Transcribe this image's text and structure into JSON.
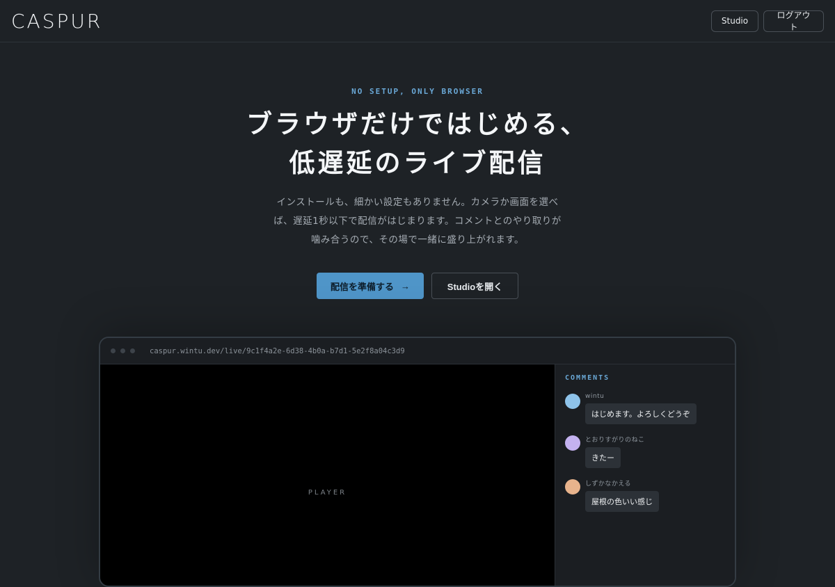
{
  "header": {
    "logo": "CASPUR",
    "studio_label": "Studio",
    "logout_label": "ログアウト"
  },
  "hero": {
    "eyebrow": "NO SETUP, ONLY BROWSER",
    "title_lines": [
      "ブラウザだけではじめる、",
      "低遅延のライブ配信"
    ],
    "lead_lines": [
      "インストールも、細かい設定もありません。カメラか画面を選べ",
      "ば、遅延1秒以下で配信がはじまります。コメントとのやり取りが",
      "噛み合うので、その場で一緒に盛り上がれます。"
    ],
    "primary_cta": "配信を準備する",
    "primary_cta_arrow": "→",
    "secondary_cta": "Studioを開く"
  },
  "preview": {
    "url": "caspur.wintu.dev/live/9c1f4a2e-6d38-4b0a-b7d1-5e2f8a04c3d9",
    "player_label": "PLAYER",
    "comments_title": "COMMENTS",
    "comments": [
      {
        "name": "wintu",
        "text": "はじめます。よろしくどうぞ",
        "avatar_color": "#8ec3ea"
      },
      {
        "name": "とおりすがりのねこ",
        "text": "きたー",
        "avatar_color": "#c4b2f0"
      },
      {
        "name": "しずかなかえる",
        "text": "屋根の色いい感じ",
        "avatar_color": "#e8b38c"
      }
    ]
  },
  "colors": {
    "background": "#1e2226",
    "accent": "#4f95c8",
    "eyebrow": "#6aa8d6"
  }
}
